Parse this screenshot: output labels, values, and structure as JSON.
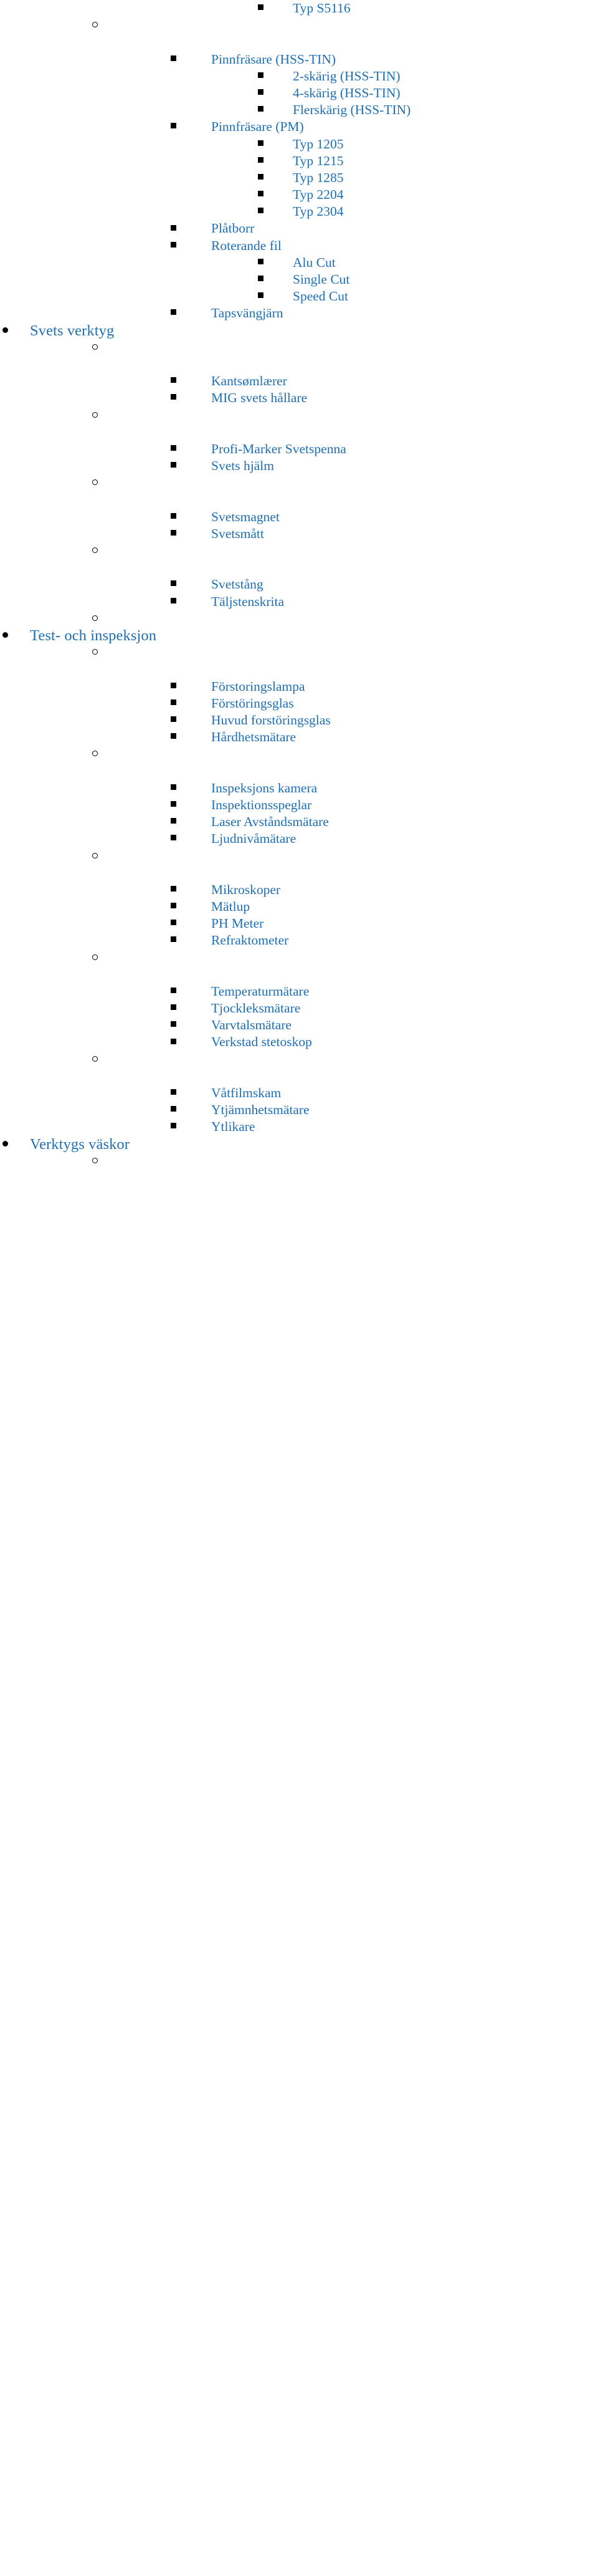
{
  "document": {
    "type": "outline-list",
    "text_color": "#1f6fb5",
    "bullet_color": "#000000",
    "background": "#ffffff",
    "bullet_glyphs": {
      "level1": "filled-round-bullet",
      "level2": "hollow-circle-bullet",
      "level3": "filled-square-bullet",
      "level4": "filled-square-bullet"
    }
  },
  "rows": [
    {
      "level": 4,
      "label": "Typ S5116"
    },
    {
      "level": 2,
      "label": ""
    },
    {
      "level": 0,
      "label": ""
    },
    {
      "level": 3,
      "label": "Pinnfräsare (HSS-TIN)"
    },
    {
      "level": 4,
      "label": "2-skärig (HSS-TIN)"
    },
    {
      "level": 4,
      "label": "4-skärig (HSS-TIN)"
    },
    {
      "level": 4,
      "label": "Flerskärig (HSS-TIN)"
    },
    {
      "level": 3,
      "label": "Pinnfräsare (PM)"
    },
    {
      "level": 4,
      "label": "Typ 1205"
    },
    {
      "level": 4,
      "label": "Typ 1215"
    },
    {
      "level": 4,
      "label": "Typ 1285"
    },
    {
      "level": 4,
      "label": "Typ 2204"
    },
    {
      "level": 4,
      "label": "Typ 2304"
    },
    {
      "level": 3,
      "label": "Plåtborr"
    },
    {
      "level": 3,
      "label": "Roterande fil"
    },
    {
      "level": 4,
      "label": "Alu Cut"
    },
    {
      "level": 4,
      "label": "Single Cut"
    },
    {
      "level": 4,
      "label": "Speed Cut"
    },
    {
      "level": 3,
      "label": "Tapsvängjärn"
    },
    {
      "level": 1,
      "label": "Svets verktyg"
    },
    {
      "level": 2,
      "label": ""
    },
    {
      "level": 0,
      "label": ""
    },
    {
      "level": 3,
      "label": "Kantsømlærer"
    },
    {
      "level": 3,
      "label": "MIG svets hållare"
    },
    {
      "level": 2,
      "label": ""
    },
    {
      "level": 0,
      "label": ""
    },
    {
      "level": 3,
      "label": "Profi-Marker Svetspenna"
    },
    {
      "level": 3,
      "label": "Svets hjälm"
    },
    {
      "level": 2,
      "label": ""
    },
    {
      "level": 0,
      "label": ""
    },
    {
      "level": 3,
      "label": "Svetsmagnet"
    },
    {
      "level": 3,
      "label": "Svetsmått"
    },
    {
      "level": 2,
      "label": ""
    },
    {
      "level": 0,
      "label": ""
    },
    {
      "level": 3,
      "label": "Svetstång"
    },
    {
      "level": 3,
      "label": "Täljstenskrita"
    },
    {
      "level": 2,
      "label": ""
    },
    {
      "level": 1,
      "label": "Test- och inspeksjon"
    },
    {
      "level": 2,
      "label": ""
    },
    {
      "level": 0,
      "label": ""
    },
    {
      "level": 3,
      "label": "Förstoringslampa"
    },
    {
      "level": 3,
      "label": "Förstöringsglas"
    },
    {
      "level": 3,
      "label": "Huvud forstöringsglas"
    },
    {
      "level": 3,
      "label": "Hårdhetsmätare"
    },
    {
      "level": 2,
      "label": ""
    },
    {
      "level": 0,
      "label": ""
    },
    {
      "level": 3,
      "label": "Inspeksjons kamera"
    },
    {
      "level": 3,
      "label": "Inspektionsspeglar"
    },
    {
      "level": 3,
      "label": "Laser Avståndsmätare"
    },
    {
      "level": 3,
      "label": "Ljudnivåmätare"
    },
    {
      "level": 2,
      "label": ""
    },
    {
      "level": 0,
      "label": ""
    },
    {
      "level": 3,
      "label": "Mikroskoper"
    },
    {
      "level": 3,
      "label": "Mätlup"
    },
    {
      "level": 3,
      "label": "PH Meter"
    },
    {
      "level": 3,
      "label": "Refraktometer"
    },
    {
      "level": 2,
      "label": ""
    },
    {
      "level": 0,
      "label": ""
    },
    {
      "level": 3,
      "label": "Temperaturmätare"
    },
    {
      "level": 3,
      "label": "Tjockleksmätare"
    },
    {
      "level": 3,
      "label": "Varvtalsmätare"
    },
    {
      "level": 3,
      "label": "Verkstad stetoskop"
    },
    {
      "level": 2,
      "label": ""
    },
    {
      "level": 0,
      "label": ""
    },
    {
      "level": 3,
      "label": "Våtfilmskam"
    },
    {
      "level": 3,
      "label": "Ytjämnhetsmätare"
    },
    {
      "level": 3,
      "label": "Ytlikare"
    },
    {
      "level": 1,
      "label": "Verktygs väskor"
    },
    {
      "level": 2,
      "label": ""
    }
  ]
}
